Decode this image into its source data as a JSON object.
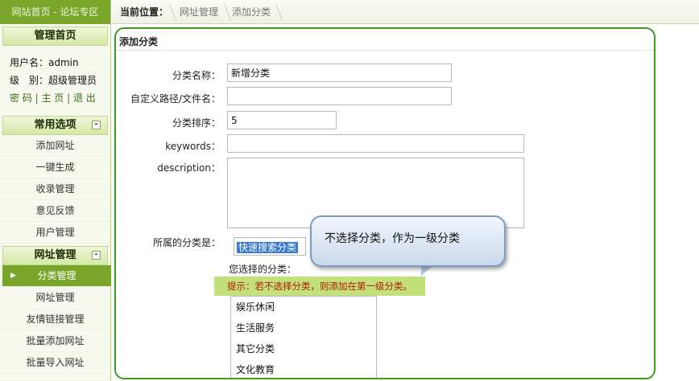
{
  "sidebar": {
    "site_links": "网站首页 - 论坛专区",
    "admin_home": "管理首页",
    "user": {
      "username": "用户名：admin",
      "level": "级　别：超级管理员",
      "links": "密 码 | 主 页 | 退 出"
    },
    "sections": [
      {
        "title": "常用选项",
        "toggle": "-",
        "items": [
          "添加网址",
          "一键生成",
          "收录管理",
          "意见反馈",
          "用户管理"
        ]
      },
      {
        "title": "网址管理",
        "toggle": "-",
        "items": [
          "分类管理",
          "网址管理",
          "友情链接管理",
          "批量添加网址",
          "批量导入网址"
        ]
      }
    ]
  },
  "topbar": {
    "label": "当前位置：",
    "crumbs": [
      "网址管理",
      "添加分类"
    ]
  },
  "form": {
    "title": "添加分类",
    "name_label": "分类名称：",
    "name_value": "新增分类",
    "path_label": "自定义路径/文件名：",
    "path_value": "",
    "order_label": "分类排序：",
    "order_value": "5",
    "keywords_label": "keywords：",
    "keywords_value": "",
    "description_label": "description：",
    "description_value": "",
    "parent_label": "所属的分类是：",
    "quick_search": "快速搜索分类",
    "chosen_label": "您选择的分类：",
    "hint": "提示：若不选择分类，则添加在第一级分类。",
    "categories": [
      "娱乐休闲",
      "生活服务",
      "其它分类",
      "文化教育"
    ]
  },
  "callout": {
    "text": "不选择分类，作为一级分类"
  },
  "colors": {
    "accent_green": "#7aa72b",
    "panel_border": "#3e9a24",
    "hint_bg": "#c3e17a",
    "hint_text": "#b0180c"
  }
}
